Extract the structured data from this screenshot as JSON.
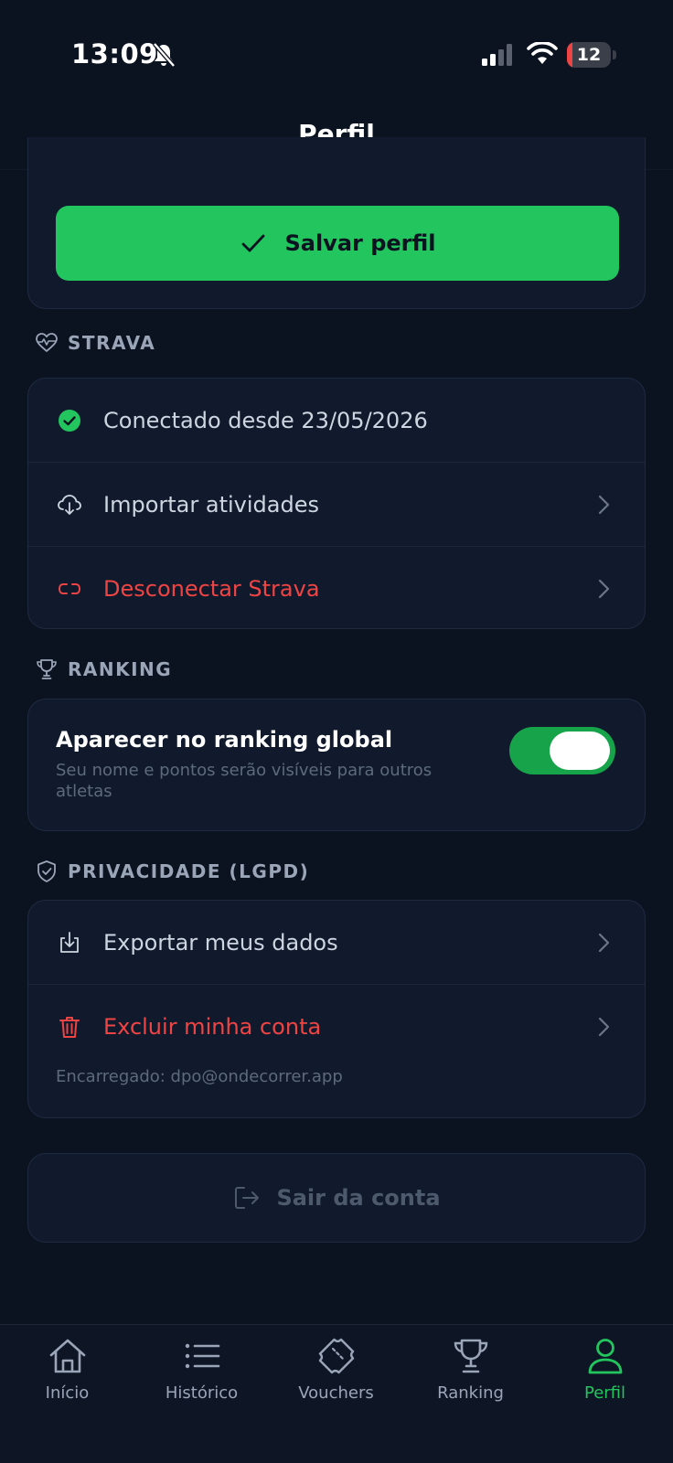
{
  "status_bar": {
    "time": "13:09",
    "battery_level": "12",
    "battery_fraction": 0.12
  },
  "header": {
    "title": "Perfil"
  },
  "save": {
    "label": "Salvar perfil"
  },
  "strava": {
    "section_title": "STRAVA",
    "rows": [
      {
        "label": "Conectado desde 23/05/2026",
        "icon": "check-circle-icon"
      },
      {
        "label": "Importar atividades",
        "icon": "cloud-download-icon"
      },
      {
        "label": "Desconectar Strava",
        "icon": "unlink-icon"
      }
    ]
  },
  "ranking": {
    "section_title": "RANKING",
    "toggle_title": "Aparecer no ranking global",
    "toggle_subtitle": "Seu nome e pontos serão visíveis para outros atletas",
    "toggle_on": true
  },
  "privacy": {
    "section_title": "PRIVACIDADE (LGPD)",
    "rows": [
      {
        "label": "Exportar meus dados",
        "icon": "download-icon"
      },
      {
        "label": "Excluir minha conta",
        "icon": "trash-icon"
      }
    ],
    "dpo_note": "Encarregado: dpo@ondecorrer.app"
  },
  "logout": {
    "label": "Sair da conta"
  },
  "tabs": [
    {
      "label": "Início",
      "icon": "home-icon",
      "active": false
    },
    {
      "label": "Histórico",
      "icon": "list-icon",
      "active": false
    },
    {
      "label": "Vouchers",
      "icon": "ticket-icon",
      "active": false
    },
    {
      "label": "Ranking",
      "icon": "trophy-icon",
      "active": false
    },
    {
      "label": "Perfil",
      "icon": "user-icon",
      "active": true
    }
  ],
  "colors": {
    "background": "#0b1220",
    "card": "#111a2d",
    "accent": "#22c55e",
    "danger": "#ef4444",
    "muted": "#9aa6b8"
  }
}
